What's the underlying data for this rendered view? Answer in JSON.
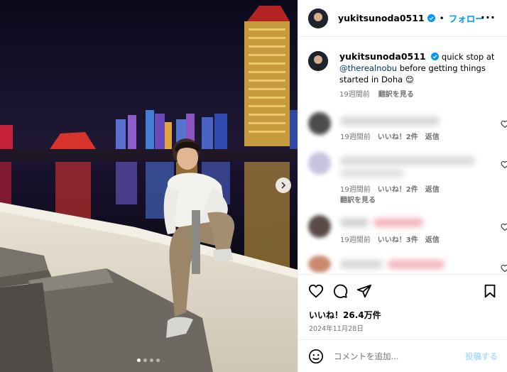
{
  "post": {
    "username": "yukitsunoda0511",
    "follow_label": "フォロー",
    "separator": "•",
    "more_icon": "more-horizontal-icon",
    "caption_text_before": " quick stop at ",
    "caption_mention": "@therealnobu",
    "caption_text_after": " before getting things started in Doha ",
    "caption_emoji": "😌",
    "caption_time": "19週間前",
    "caption_translate": "翻訳を見る",
    "accent_color": "#0095f6"
  },
  "comments": [
    {
      "time": "19週間前",
      "likes": "いいね！2件",
      "reply": "返信",
      "translate": ""
    },
    {
      "time": "19週間前",
      "likes": "いいね！2件",
      "reply": "返信",
      "translate": "翻訳を見る"
    },
    {
      "time": "19週間前",
      "likes": "いいね！3件",
      "reply": "返信",
      "translate": ""
    }
  ],
  "actions": {
    "likes": "いいね！26.4万件",
    "date": "2024年11月28日",
    "comment_placeholder": "コメントを追加...",
    "post_label": "投稿する"
  },
  "carousel": {
    "total": 4,
    "active_index": 0
  }
}
